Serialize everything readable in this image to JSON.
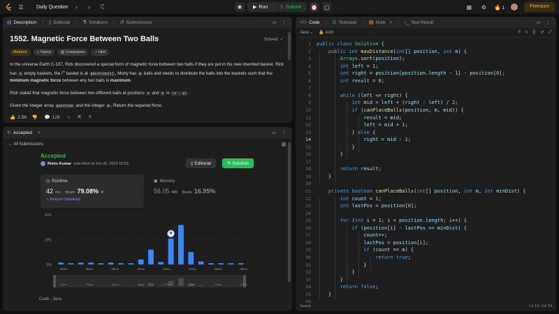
{
  "topbar": {
    "title": "Daily Question",
    "run_label": "Run",
    "submit_label": "Submit",
    "streak_count": "1",
    "premium_label": "Premium"
  },
  "description": {
    "tabs": [
      {
        "label": "Description"
      },
      {
        "label": "Editorial"
      },
      {
        "label": "Solutions"
      },
      {
        "label": "Submissions"
      }
    ],
    "title": "1552. Magnetic Force Between Two Balls",
    "solved_label": "Solved",
    "tags": [
      "Medium",
      "Topics",
      "Companies",
      "Hint"
    ],
    "p1a": "In the universe Earth C-137, Rick discovered a special form of magnetic force between two balls if they are put in his new invented basket.",
    "p1b": "Rick has",
    "p1_n": "n",
    "p1c": "empty baskets, the",
    "p1_ith": "i",
    "p1_th": "th",
    "p1d": "basket is at",
    "p1_pos": "position[i]",
    "p1e": ", Morty has",
    "p1_m": "m",
    "p1f": "balls and needs to distribute the balls into the baskets such",
    "p1g": "that the",
    "p1_bold": "minimum magnetic force",
    "p1h": "between any two balls is",
    "p1_max": "maximum",
    "p1i": ".",
    "p2a": "Rick stated that magnetic force between two different balls at positions",
    "p2_x": "x",
    "p2b": "and",
    "p2_y": "y",
    "p2c": "is",
    "p2_xy": "|x - y|",
    "p2d": ".",
    "p3a": "Given the integer array",
    "p3_pos": "position",
    "p3b": "and the integer",
    "p3_m": "m",
    "p3c": ". Return",
    "p3_it": "the required force",
    "p3d": ".",
    "likes": "2.5K",
    "comments": "129"
  },
  "submission": {
    "tab_label": "Accepted",
    "nav_label": "All Submissions",
    "status": "Accepted",
    "user": "Rishu Kumar",
    "submitted_text": "submitted at Jun 20, 2024 16:53",
    "editorial_label": "Editorial",
    "solution_label": "Solution",
    "runtime_label": "Runtime",
    "runtime_value": "42",
    "runtime_unit": "ms",
    "beats_label": "Beats",
    "runtime_beats": "79.08%",
    "analyze_label": "Analyze Complexity",
    "memory_label": "Memory",
    "memory_value": "56.05",
    "memory_unit": "MB",
    "memory_beats": "16.95%",
    "code_label": "Code",
    "lang_label": "Java"
  },
  "chart_data": {
    "type": "bar",
    "ylim": [
      0,
      40
    ],
    "yticks": [
      "40%",
      "20%",
      "0%"
    ],
    "xtick_labels": [
      "34ms",
      "36ms",
      "38ms",
      "40ms",
      "42ms",
      "44ms",
      "46ms",
      "48ms"
    ],
    "values": [
      1.5,
      1,
      1.5,
      1.5,
      1,
      1.5,
      1,
      1,
      4,
      12,
      2,
      21,
      32,
      10,
      2.5,
      1,
      1,
      1,
      1
    ],
    "highlight_index": 11,
    "mini_labels": [
      "34ms",
      "36ms",
      "38ms",
      "40ms",
      "42ms",
      "44ms",
      "46ms",
      "48ms"
    ]
  },
  "editor": {
    "tabs": [
      {
        "label": "Code"
      },
      {
        "label": "Testcase"
      },
      {
        "label": "Note"
      },
      {
        "label": "Test Result"
      }
    ],
    "language": "Java",
    "auto_label": "Auto",
    "saved_label": "Saved",
    "cursor_label": "Ln 14, Col 33",
    "current_line": 14,
    "lines": [
      "public class Solution {",
      "    public int maxDistance(int[] position, int m) {",
      "        Arrays.sort(position);",
      "        int left = 1;",
      "        int right = position[position.length - 1] - position[0];",
      "        int result = 0;",
      "",
      "        while (left <= right) {",
      "            int mid = left + (right - left) / 2;",
      "            if (canPlaceBalls(position, m, mid)) {",
      "                result = mid;",
      "                left = mid + 1;",
      "            } else {",
      "                right = mid - 1;",
      "            }",
      "        }",
      "",
      "        return result;",
      "    }",
      "",
      "    private boolean canPlaceBalls(int[] position, int m, int minDist) {",
      "        int count = 1;",
      "        int lastPos = position[0];",
      "",
      "        for (int i = 1; i < position.length; i++) {",
      "            if (position[i] - lastPos >= minDist) {",
      "                count++;",
      "                lastPos = position[i];",
      "                if (count == m) {",
      "                    return true;",
      "                }",
      "            }",
      "        }",
      "        return false;",
      "    }",
      ""
    ]
  }
}
